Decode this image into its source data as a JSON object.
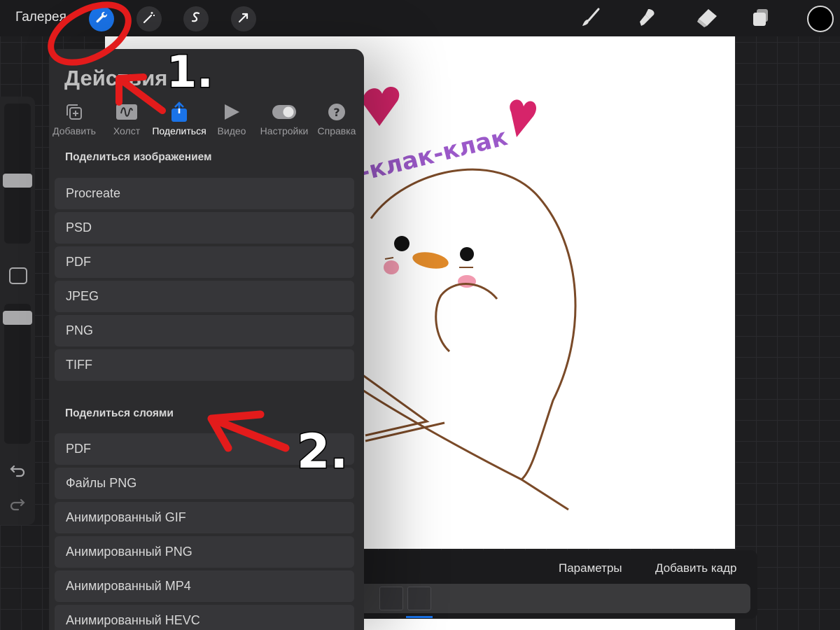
{
  "toolbar": {
    "gallery_label": "Галерея",
    "left_tools": [
      "wrench-icon",
      "magic-wand-icon",
      "selection-icon",
      "transform-icon"
    ],
    "right_tools": [
      "brush-icon",
      "smudge-icon",
      "eraser-icon",
      "layers-icon"
    ],
    "current_color": "#000000",
    "accent_color": "#1a73e8"
  },
  "actions_panel": {
    "title": "Действия",
    "tabs": [
      {
        "label": "Добавить",
        "icon": "add-icon"
      },
      {
        "label": "Холст",
        "icon": "canvas-icon"
      },
      {
        "label": "Поделиться",
        "icon": "share-icon",
        "active": true
      },
      {
        "label": "Видео",
        "icon": "play-icon"
      },
      {
        "label": "Настройки",
        "icon": "toggle-icon"
      },
      {
        "label": "Справка",
        "icon": "help-icon"
      }
    ],
    "share_image": {
      "heading": "Поделиться изображением",
      "items": [
        "Procreate",
        "PSD",
        "PDF",
        "JPEG",
        "PNG",
        "TIFF"
      ]
    },
    "share_layers": {
      "heading": "Поделиться слоями",
      "items": [
        "PDF",
        "Файлы PNG",
        "Анимированный GIF",
        "Анимированный PNG",
        "Анимированный MP4",
        "Анимированный HEVC"
      ]
    }
  },
  "timeline": {
    "params_label": "Параметры",
    "add_frame_label": "Добавить кадр"
  },
  "canvas": {
    "text": "-клак-клак"
  },
  "annotations": {
    "step1": "1.",
    "step2": "2.",
    "color": "#e31b1b"
  }
}
